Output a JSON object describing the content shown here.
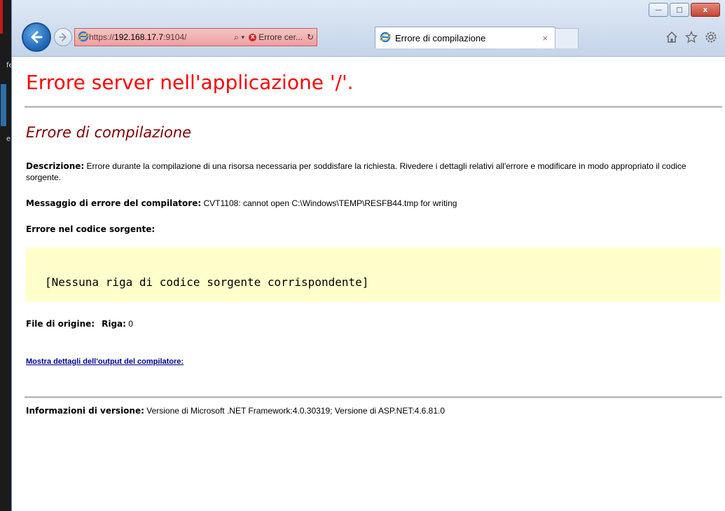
{
  "window": {
    "minimize_symbol": "—",
    "maximize_symbol": "□",
    "close_symbol": "x"
  },
  "address_bar": {
    "url_scheme": "https://",
    "url_host": "192.168.17.7",
    "url_port": ":9104/",
    "search_symbol": "⌕ ▾",
    "certificate_error_label": "Errore cer...",
    "refresh_symbol": "↻"
  },
  "tab": {
    "title": "Errore di compilazione",
    "close_symbol": "×"
  },
  "toolbar_icons": [
    "home-icon",
    "favorites-star-icon",
    "settings-gear-icon"
  ],
  "left_strip": {
    "letters": [
      "fe",
      "e"
    ]
  },
  "page": {
    "title": "Errore server nell'applicazione '/'.",
    "subtitle": "Errore di compilazione",
    "description_label": "Descrizione:",
    "description_text": " Errore durante la compilazione di una risorsa necessaria per soddisfare la richiesta. Rivedere i dettagli relativi all'errore e modificare in modo appropriato il codice sorgente.",
    "compiler_message_label": "Messaggio di errore del compilatore:",
    "compiler_message_text": " CVT1108: cannot open C:\\Windows\\TEMP\\RESFB44.tmp for writing",
    "source_error_label": "Errore nel codice sorgente:",
    "source_code_line": "[Nessuna riga di codice sorgente corrispondente]",
    "source_file_label": "File di origine:",
    "line_label": "Riga:",
    "line_value": " 0",
    "details_link": "Mostra dettagli dell'output del compilatore:",
    "version_label": "Informazioni di versione:",
    "version_text": " Versione di Microsoft .NET Framework:4.0.30319; Versione di ASP.NET:4.6.81.0"
  },
  "colors": {
    "title": "#ff0000",
    "subtitle": "#800000",
    "code_background": "#ffffcc",
    "link": "#000099"
  }
}
